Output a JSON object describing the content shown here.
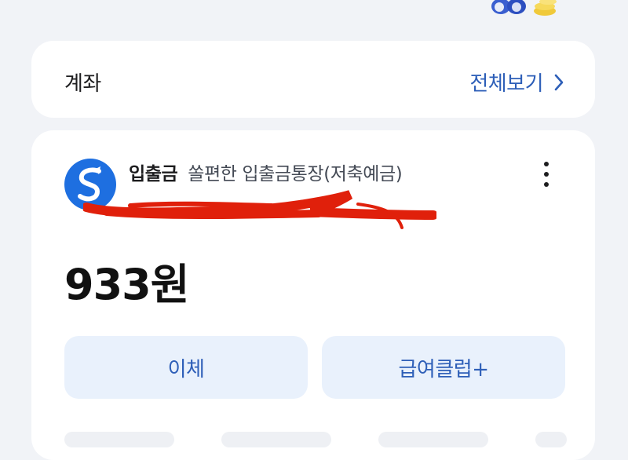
{
  "header": {
    "title": "계좌",
    "view_all_label": "전체보기",
    "chevron_icon": "chevron-right-icon"
  },
  "account": {
    "bank_logo_icon": "shinhan-bank-logo",
    "type_label": "입출금",
    "product_name": "쏠편한 입출금통장(저축예금)",
    "more_icon": "more-vertical-icon",
    "balance": "933원"
  },
  "actions": {
    "transfer_label": "이체",
    "salary_club_label": "급여클럽+"
  },
  "colors": {
    "accent": "#2e5fb8",
    "button_bg": "#e9f1fc",
    "page_bg": "#f1f3f7",
    "logo_blue": "#1e6fe0",
    "redaction": "#e0200b"
  }
}
